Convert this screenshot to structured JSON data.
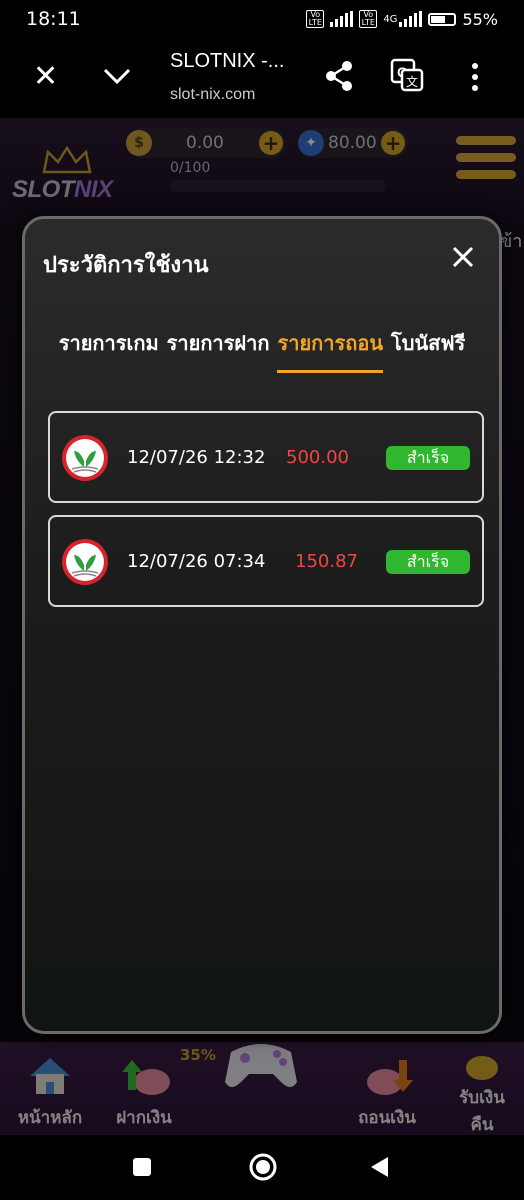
{
  "status_bar": {
    "time": "18:11",
    "battery": "55%",
    "net_4g": "4G",
    "volte1": "Vo LTE",
    "volte2": "Vo LTE"
  },
  "browser": {
    "title": "SLOTNIX -...",
    "url": "slot-nix.com"
  },
  "site": {
    "logo_a": "SLOT",
    "logo_b": "NIX",
    "balance": "0.00",
    "points": "80.00",
    "progress": "0/100",
    "bottom_nav": {
      "home": "หน้าหลัก",
      "deposit": "ฝากเงิน",
      "withdraw": "ถอนเงิน",
      "cashback_1": "รับเงิน",
      "cashback_2": "คืน",
      "badge": "35%"
    },
    "side_text": "ข้า"
  },
  "modal": {
    "title": "ประวัติการใช้งาน",
    "tabs": [
      {
        "label": "รายการเกม",
        "active": false
      },
      {
        "label": "รายการฝาก",
        "active": false
      },
      {
        "label": "รายการถอน",
        "active": true
      },
      {
        "label": "โบนัสฟรี",
        "active": false
      }
    ],
    "transactions": [
      {
        "datetime": "12/07/26 12:32",
        "amount": "500.00",
        "status": "สำเร็จ"
      },
      {
        "datetime": "12/07/26 07:34",
        "amount": "150.87",
        "status": "สำเร็จ"
      }
    ]
  },
  "colors": {
    "accent": "#f0a52a",
    "success": "#2fb82f",
    "amount": "#f04444",
    "bank": "#d8232a"
  }
}
